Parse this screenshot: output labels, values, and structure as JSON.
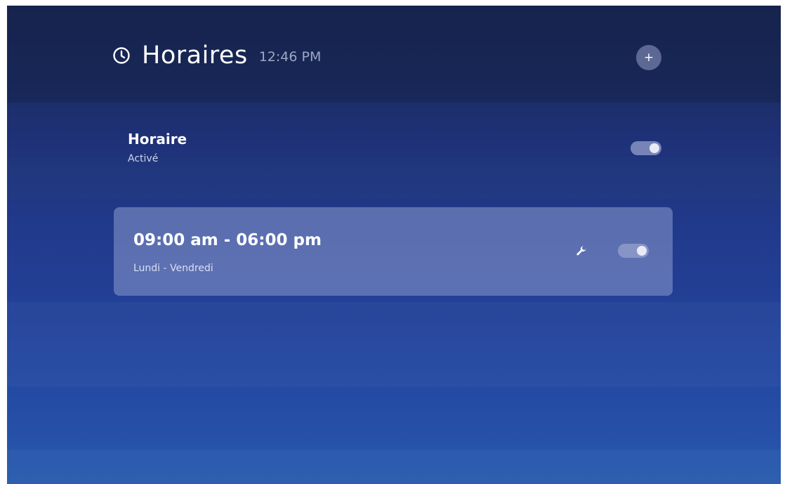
{
  "header": {
    "icon": "clock-icon",
    "title": "Horaires",
    "time": "12:46 PM",
    "add_label": "+"
  },
  "master_schedule": {
    "title": "Horaire",
    "status": "Activé",
    "enabled": true
  },
  "schedules": [
    {
      "time_range": "09:00 am - 06:00 pm",
      "days": "Lundi - Vendredi",
      "settings_icon": "wrench-icon",
      "enabled": true
    }
  ],
  "colors": {
    "background_top": "#1a2755",
    "background_bottom": "#2a5aae",
    "card": "#6e7cb8",
    "toggle_track": "#969fcd",
    "toggle_knob": "#e8ebf5"
  }
}
